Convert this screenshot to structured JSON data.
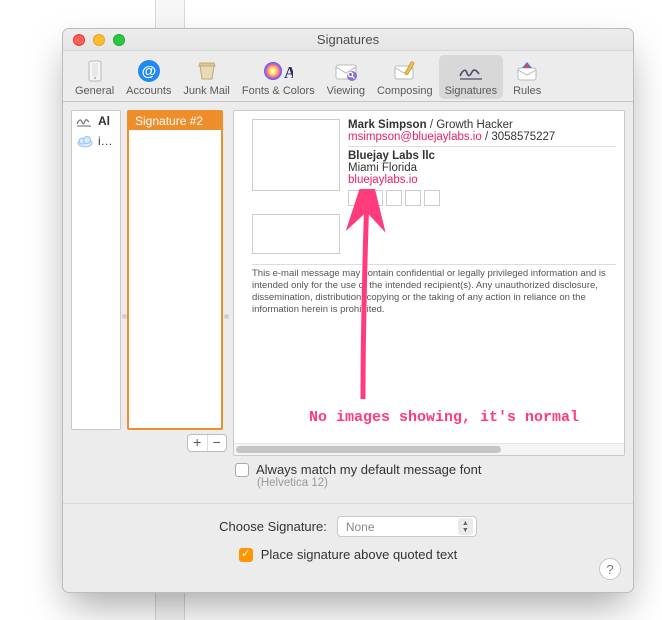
{
  "window": {
    "title": "Signatures"
  },
  "toolbar": {
    "items": [
      {
        "label": "General"
      },
      {
        "label": "Accounts"
      },
      {
        "label": "Junk Mail"
      },
      {
        "label": "Fonts & Colors"
      },
      {
        "label": "Viewing"
      },
      {
        "label": "Composing"
      },
      {
        "label": "Signatures"
      },
      {
        "label": "Rules"
      }
    ]
  },
  "accounts": {
    "items": [
      {
        "label": "Al"
      },
      {
        "label": "i…"
      }
    ]
  },
  "signatures": {
    "selected_label": "Signature #2"
  },
  "preview": {
    "name": "Mark Simpson",
    "role": "Growth Hacker",
    "email": "msimpson@bluejaylabs.io",
    "phone": "3058575227",
    "company": "Bluejay Labs llc",
    "location": "Miami Florida",
    "website": "bluejaylabs.io",
    "disclaimer": "This e-mail message may contain confidential or legally privileged information and is intended only for the use of the intended recipient(s). Any unauthorized disclosure, dissemination, distribution, copying or the taking of any action in reliance on the information herein is prohibited."
  },
  "options": {
    "match_font_label": "Always match my default message font",
    "font_hint": "(Helvetica 12)",
    "choose_label": "Choose Signature:",
    "choose_value": "None",
    "place_above_label": "Place signature above quoted text"
  },
  "annotation": {
    "text": "No images showing, it's normal"
  }
}
